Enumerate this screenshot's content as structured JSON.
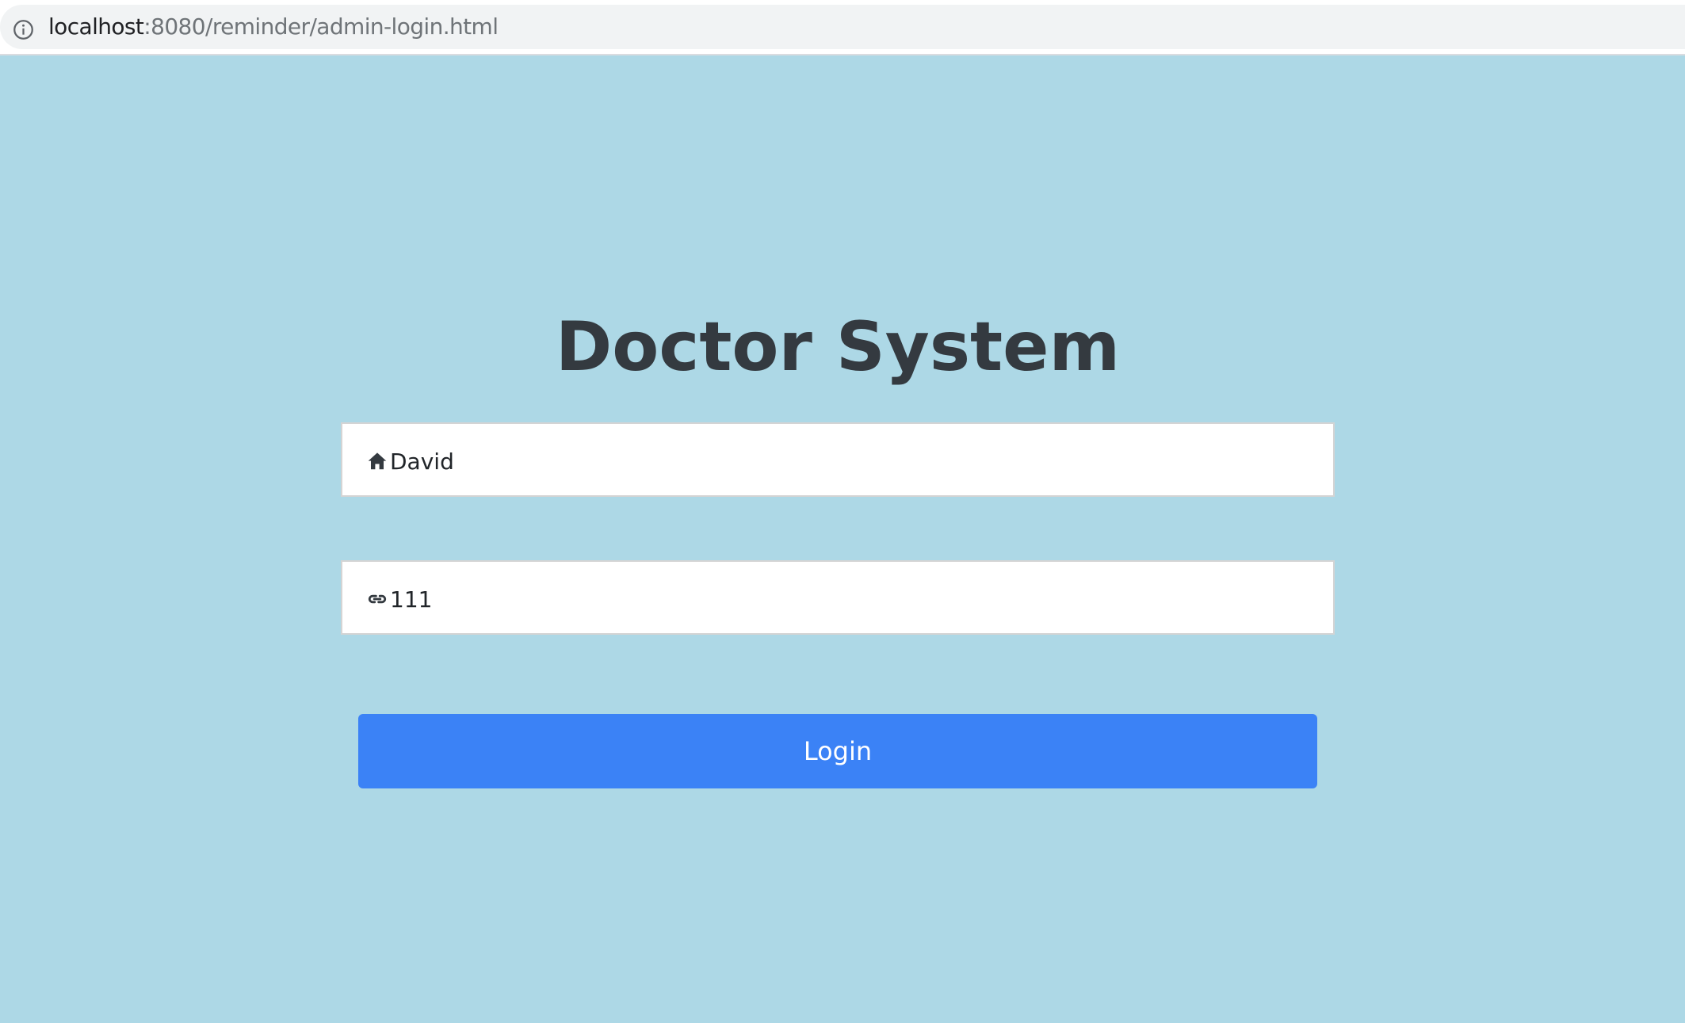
{
  "browser": {
    "url_host": "localhost",
    "url_path": ":8080/reminder/admin-login.html"
  },
  "login": {
    "title": "Doctor System",
    "username": {
      "value": "David",
      "icon": "home-icon"
    },
    "password": {
      "value": "111",
      "icon": "link-icon"
    },
    "button_label": "Login"
  },
  "colors": {
    "background": "#add8e6",
    "button": "#3b82f6",
    "title": "#343a40"
  }
}
